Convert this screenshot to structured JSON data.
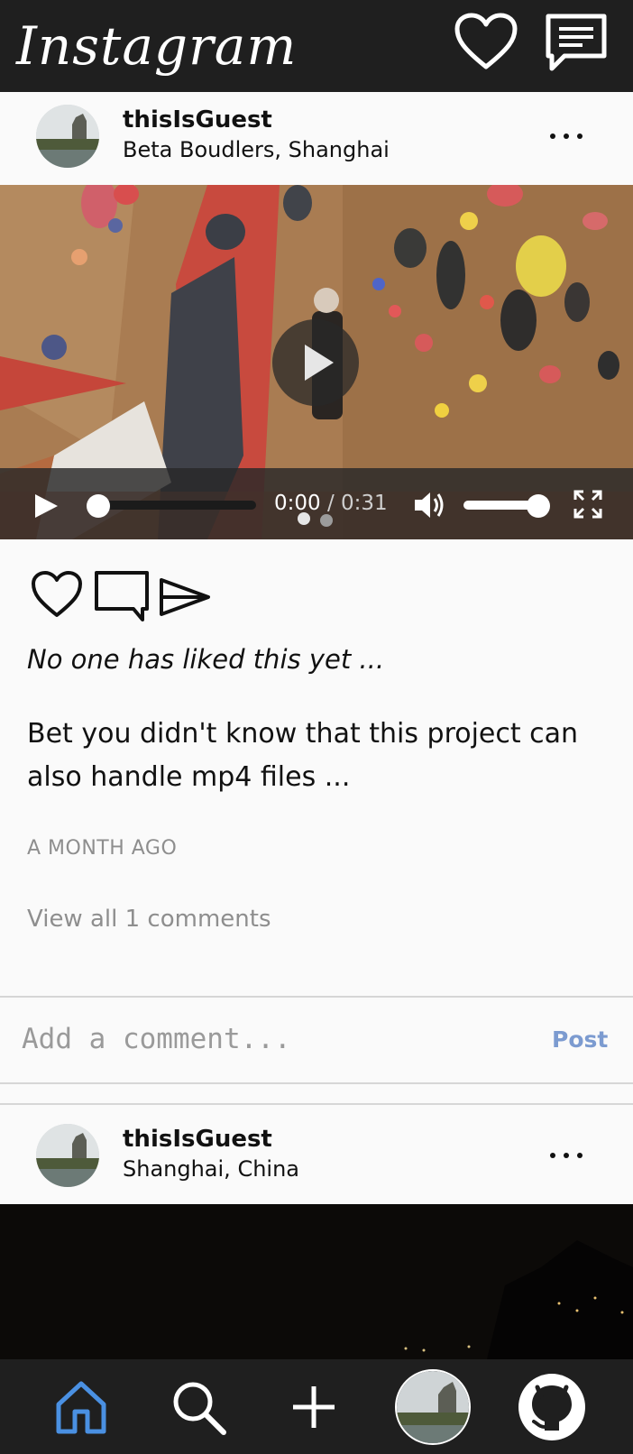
{
  "header": {
    "brand": "Instagram",
    "icons": [
      "heart-icon",
      "message-icon"
    ]
  },
  "posts": [
    {
      "username": "thisIsGuest",
      "location": "Beta Boudlers, Shanghai",
      "media_type": "video",
      "video": {
        "current_time": "0:00",
        "separator": "/",
        "duration": "0:31",
        "progress": 0.0,
        "volume": 1.0
      },
      "likes_text": "No one has liked this yet ...",
      "caption": "Bet you didn't know that this project can also handle mp4 files ...",
      "time_ago": "A MONTH AGO",
      "view_comments": "View all 1 comments",
      "comment_placeholder": "Add a comment...",
      "post_label": "Post"
    },
    {
      "username": "thisIsGuest",
      "location": "Shanghai, China"
    }
  ],
  "bottom_nav": {
    "items": [
      "home-icon",
      "search-icon",
      "add-icon",
      "profile-avatar",
      "github-icon"
    ],
    "active": "home-icon"
  },
  "colors": {
    "bar_bg": "#1f1f1f",
    "page_bg": "#fafafa",
    "active_nav": "#4a90e2",
    "post_button": "#7c9bd0",
    "muted_text": "#8e8e8e"
  }
}
